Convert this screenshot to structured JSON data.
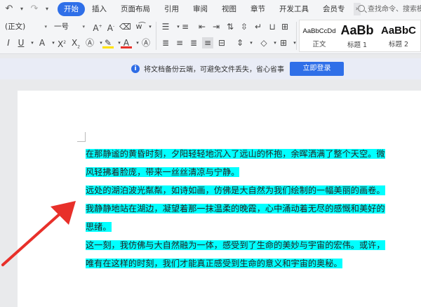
{
  "menubar": {
    "tabs": [
      {
        "label": "开始"
      },
      {
        "label": "插入"
      },
      {
        "label": "页面布局"
      },
      {
        "label": "引用"
      },
      {
        "label": "审阅"
      },
      {
        "label": "视图"
      },
      {
        "label": "章节"
      },
      {
        "label": "开发工具"
      },
      {
        "label": "会员专"
      }
    ],
    "more_symbol": "›",
    "search_placeholder": "查找命令、搜索模"
  },
  "ribbon": {
    "style_select": "(正文)",
    "size_select": "一号",
    "styles": [
      {
        "sample": "AaBbCcDd",
        "label": "正文"
      },
      {
        "sample": "AaBb",
        "label": "标题 1"
      },
      {
        "sample": "AaBbC",
        "label": "标题 2"
      }
    ]
  },
  "notice": {
    "text": "将文档备份云端，可避免文件丢失，省心省事",
    "button_label": "立即登录"
  },
  "document": {
    "lines": [
      {
        "text": "在那静谧的黄昏时刻，夕阳轻轻地沉入了远山的怀抱，余晖洒满了整个天空。微"
      },
      {
        "text": "风轻拂着脸庞，带来一丝丝清凉与宁静。"
      },
      {
        "text": "远处的湖泊波光粼粼，如诗如画，仿佛是大自然为我们绘制的一幅美丽的画卷。"
      },
      {
        "text": "我静静地站在湖边，凝望着那一抹温柔的晚霞，心中涌动着无尽的感慨和美好的"
      },
      {
        "text": "思绪。"
      },
      {
        "text": "这一刻，我仿佛与大自然融为一体，感受到了生命的美妙与宇宙的宏伟。或许，"
      },
      {
        "text": "唯有在这样的时刻，我们才能真正感受到生命的意义和宇宙的奥秘。"
      }
    ]
  },
  "colors": {
    "accent": "#2f6fe8",
    "highlight": "#00ffff",
    "arrow": "#e8302a"
  }
}
